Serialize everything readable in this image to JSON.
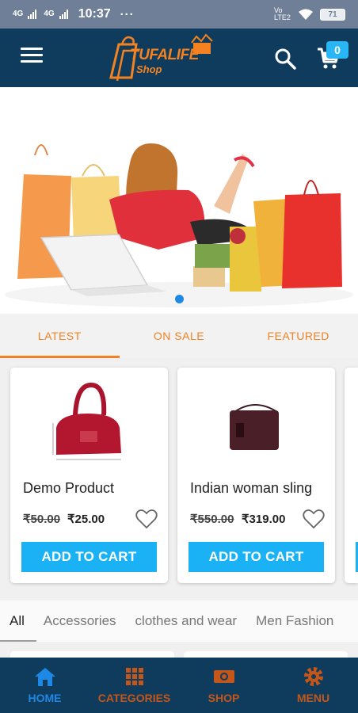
{
  "status_bar": {
    "signal_1": "4G",
    "signal_2": "4G",
    "time": "10:37",
    "more": "···",
    "network": "Vo LTE2",
    "battery": "71"
  },
  "header": {
    "logo_text": "TUFALIFE",
    "logo_sub": "Shop",
    "cart_count": "0"
  },
  "tabs": [
    {
      "label": "LATEST"
    },
    {
      "label": "ON SALE"
    },
    {
      "label": "FEATURED"
    }
  ],
  "products": [
    {
      "name": "Demo Product",
      "old_price": "₹50.00",
      "price": "₹25.00",
      "button": "ADD TO CART"
    },
    {
      "name": "Indian woman sling",
      "old_price": "₹550.00",
      "price": "₹319.00",
      "button": "ADD TO CART"
    }
  ],
  "categories": [
    {
      "label": "All"
    },
    {
      "label": "Accessories"
    },
    {
      "label": "clothes and wear"
    },
    {
      "label": "Men Fashion"
    }
  ],
  "bottom_nav": [
    {
      "label": "HOME",
      "icon": "home-icon"
    },
    {
      "label": "CATEGORIES",
      "icon": "grid-icon"
    },
    {
      "label": "SHOP",
      "icon": "money-icon"
    },
    {
      "label": "MENU",
      "icon": "gear-icon"
    }
  ],
  "colors": {
    "app_bar": "#0f3c5c",
    "accent": "#f58220",
    "button": "#1ab2f5",
    "active_nav": "#1e88e5"
  }
}
